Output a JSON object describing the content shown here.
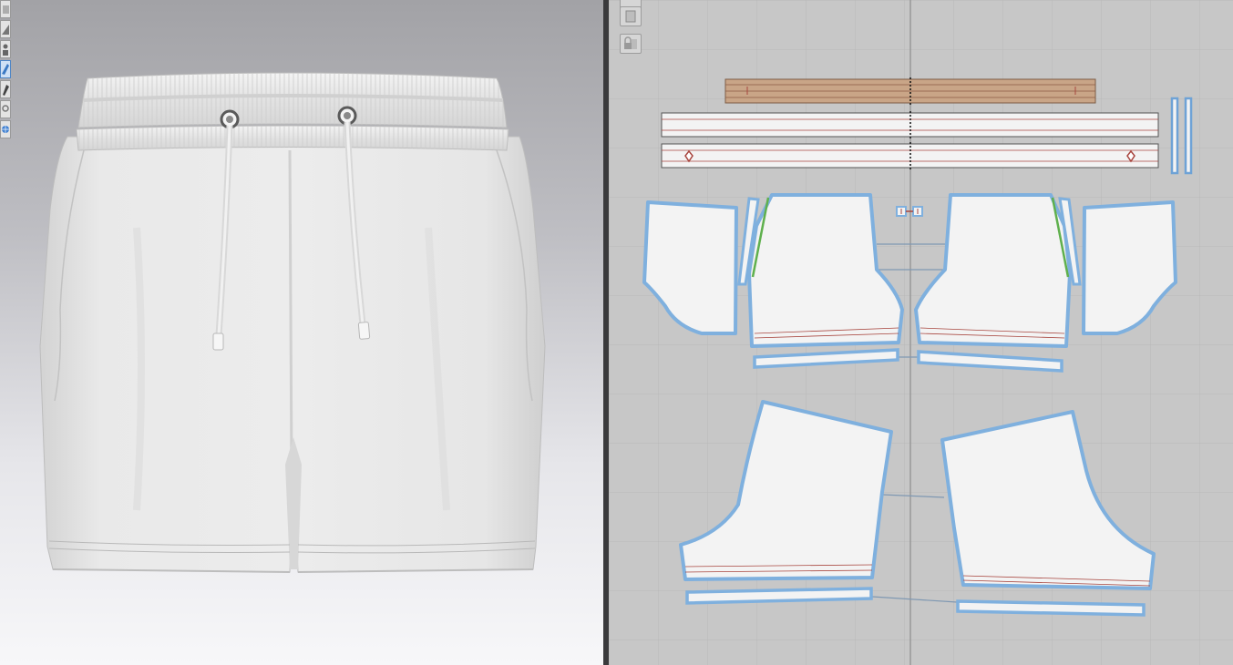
{
  "viewport_3d": {
    "garment": "shorts-with-drawstring",
    "toolbar_icons": [
      "transparent-icon",
      "avatar-icon",
      "fabric-select-icon",
      "pin-icon",
      "zoom-icon",
      "globe-icon"
    ]
  },
  "viewport_2d": {
    "toolbar_icons": [
      "pattern-copy-icon",
      "lock-pattern-icon"
    ],
    "pieces": [
      "waistband-elastic",
      "waistband-outer",
      "waistband-inner",
      "drawcord",
      "side-pocket-left",
      "front-left",
      "cord-eyelets",
      "front-right",
      "side-pocket-right",
      "front-hem-left",
      "front-hem-right",
      "back-left",
      "back-right",
      "back-hem-left",
      "back-hem-right"
    ]
  },
  "colors": {
    "piece_outline": "#7fb0de",
    "piece_fill": "#f3f3f3",
    "elastic_fill": "#c9a587",
    "seam_line": "#a8463f",
    "grid_line": "#b6b6b6"
  }
}
